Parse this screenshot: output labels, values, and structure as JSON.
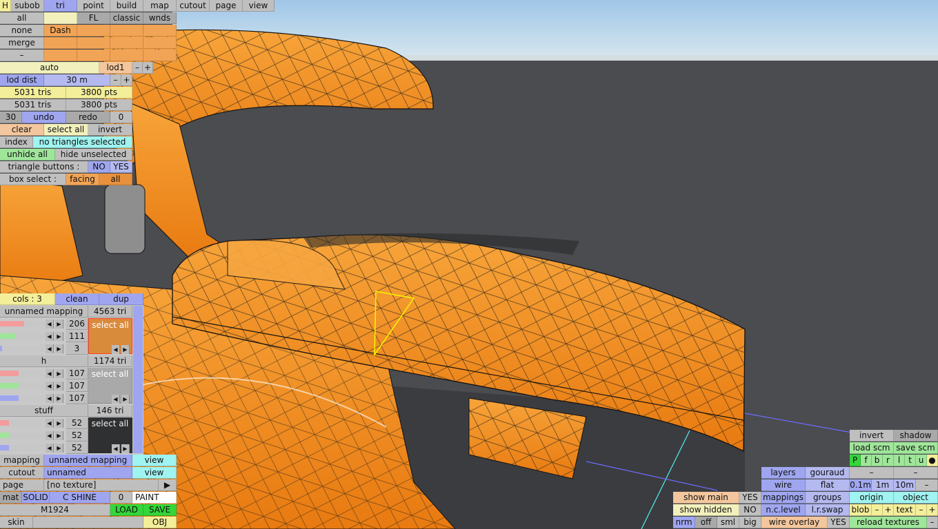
{
  "top_tabs": [
    "H",
    "subob",
    "tri",
    "point",
    "build",
    "map",
    "cutout",
    "page",
    "view"
  ],
  "select_row": {
    "all": "all",
    "fl": "FL",
    "classic": "classic",
    "wnds": "wnds"
  },
  "side_labels": {
    "none": "none",
    "merge": "merge",
    "dash_label": "–"
  },
  "layer_dash": "Dash",
  "lod": {
    "auto": "auto",
    "lod": "lod1",
    "minus": "–",
    "plus": "+",
    "dist_label": "lod dist",
    "dist_value": "30 m"
  },
  "counts": {
    "tris1": "5031 tris",
    "pts1": "3800 pts",
    "tris2": "5031 tris",
    "pts2": "3800 pts"
  },
  "history": {
    "steps": "30",
    "undo": "undo",
    "redo": "redo",
    "redo_count": "0"
  },
  "selection": {
    "clear": "clear",
    "select_all": "select all",
    "invert": "invert",
    "index": "index",
    "status": "no triangles selected",
    "unhide_all": "unhide all",
    "hide_unselected": "hide unselected"
  },
  "tri_buttons": {
    "label": "triangle buttons :",
    "no": "NO",
    "yes": "YES"
  },
  "box_select": {
    "label": "box select :",
    "facing": "facing",
    "all": "all"
  },
  "mapping_panel": {
    "cols": "cols : 3",
    "clean": "clean",
    "dup": "dup",
    "groups": [
      {
        "name": "unnamed mapping",
        "tris": "4563 tri",
        "vals": [
          "206",
          "111",
          "3"
        ],
        "select_all": "select all",
        "fraction": [
          0.55,
          0.35,
          0.05
        ]
      },
      {
        "name": "h",
        "tris": "1174 tri",
        "vals": [
          "107",
          "107",
          "107"
        ],
        "select_all": "select all",
        "fraction": [
          0.42,
          0.42,
          0.42
        ]
      },
      {
        "name": "stuff",
        "tris": "146 tri",
        "vals": [
          "52",
          "52",
          "52"
        ],
        "select_all": "select all",
        "fraction": [
          0.2,
          0.2,
          0.2
        ]
      }
    ]
  },
  "bottom_left": {
    "mapping_label": "mapping",
    "mapping_value": "unnamed mapping",
    "mapping_view": "view",
    "cutout_label": "cutout",
    "cutout_value": "unnamed",
    "cutout_view": "view",
    "page_label": "page",
    "page_value": "[no texture]",
    "page_arrow": "▶",
    "mat": "mat",
    "solid": "SOLID",
    "c_shine": "C SHINE",
    "zero": "0",
    "paint": "PAINT",
    "material_name": "M1924",
    "load": "LOAD",
    "save": "SAVE",
    "skin": "skin",
    "obj": "OBJ"
  },
  "bottom_right": {
    "show_main": "show main",
    "show_main_val": "YES",
    "show_hidden": "show hidden",
    "show_hidden_val": "NO",
    "nrm": "nrm",
    "off": "off",
    "sml": "sml",
    "big": "big",
    "layers": "layers",
    "gouraud": "gouraud",
    "wire": "wire",
    "flat": "flat",
    "mappings": "mappings",
    "groups": "groups",
    "nc_level": "n.c.level",
    "lr_swap": "l.r.swap",
    "wire_overlay": "wire overlay",
    "wire_overlay_val": "YES",
    "invert": "invert",
    "shadow": "shadow",
    "load_scm": "load scm",
    "save_scm": "save scm",
    "views": [
      "P",
      "f",
      "b",
      "r",
      "l",
      "t",
      "u",
      "●"
    ],
    "dash1": "–",
    "dash2": "–",
    "g01": "0.1m",
    "g1": "1m",
    "g10": "10m",
    "gminus": "–",
    "origin": "origin",
    "object": "object",
    "blob": "blob",
    "blob_minus": "–",
    "blob_plus": "+",
    "text": "text",
    "text_minus": "–",
    "text_plus": "+",
    "reload_textures": "reload textures",
    "reload_minus": "–"
  },
  "colors": {
    "mesh": "#f08a1f",
    "wire": "#111111",
    "selection": "#f4f400",
    "sky": "#b8d4ea",
    "bg": "#4a4c50"
  }
}
